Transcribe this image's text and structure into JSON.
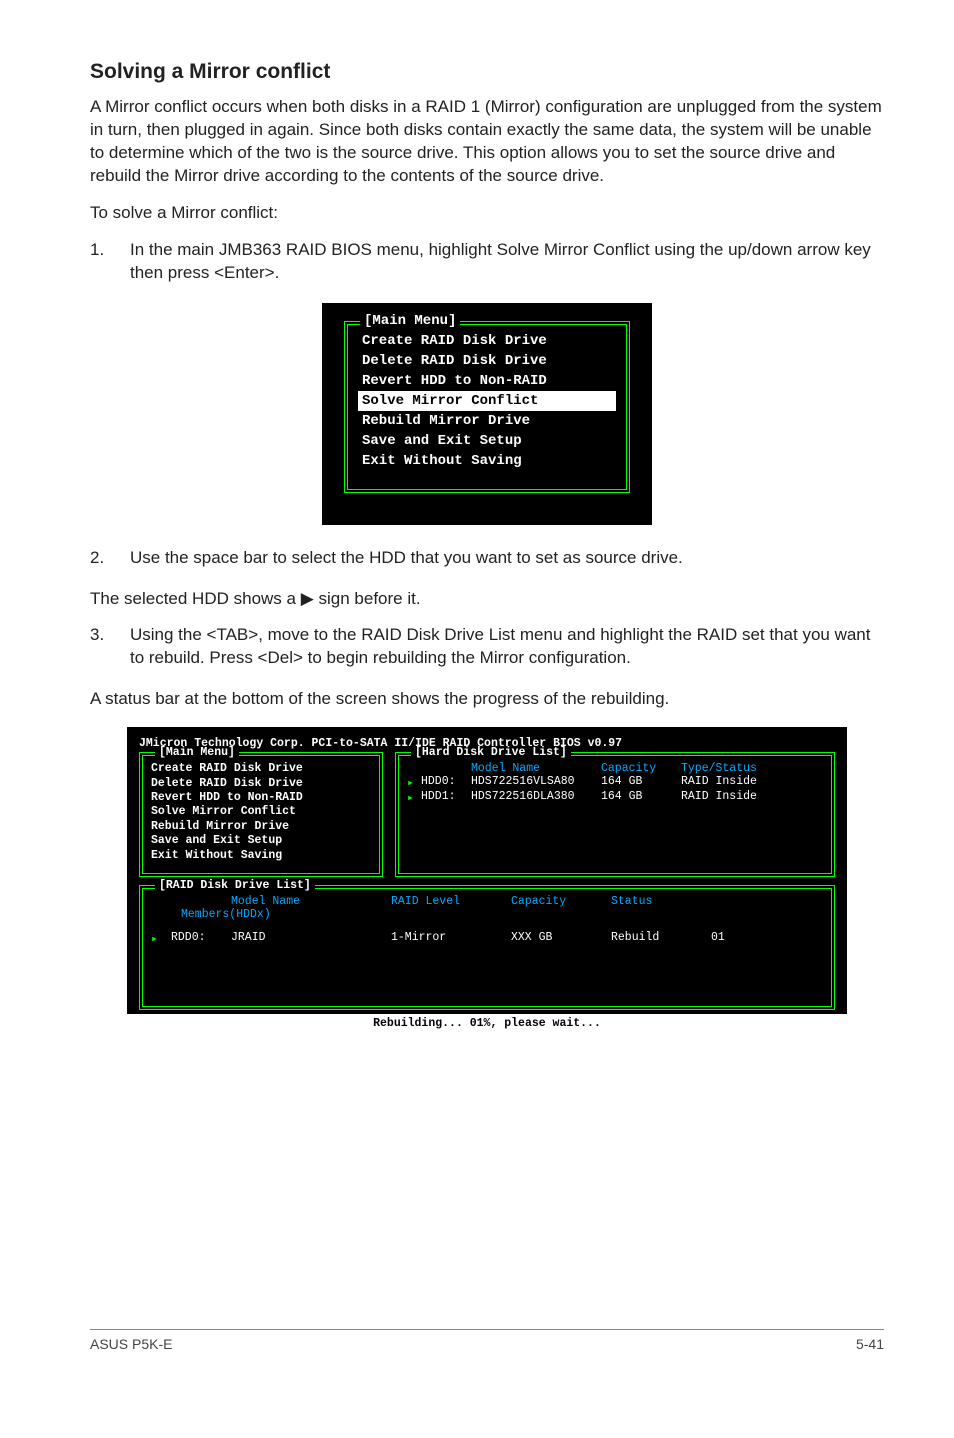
{
  "section": {
    "title": "Solving a Mirror conflict",
    "intro": "A Mirror conflict occurs when both disks in a RAID 1 (Mirror) configuration are unplugged from the system in turn, then plugged in again. Since both disks contain exactly the same data, the system will be unable to determine which of the two is the source drive. This option allows you to set the source drive and rebuild the Mirror drive according to the contents of the source drive.",
    "lead": "To solve a Mirror conflict:"
  },
  "steps": {
    "s1_num": "1.",
    "s1_text": "In the main JMB363 RAID BIOS menu, highlight Solve Mirror Conflict using the up/down arrow key then press <Enter>.",
    "s2_num": "2.",
    "s2_text_a": "Use the space bar to select the HDD that you want to set as source drive.",
    "s2_text_b_pre": "The selected HDD shows a ",
    "s2_text_b_post": " sign before it.",
    "s3_num": "3.",
    "s3_text": "Using the <TAB>, move to the RAID Disk Drive List menu and highlight the RAID set that you want to rebuild. Press <Del> to begin rebuilding the Mirror configuration.",
    "s3_follow": "A status bar at the bottom of the screen shows the progress of the rebuilding."
  },
  "bios_small": {
    "title": "[Main Menu]",
    "items": [
      "Create RAID Disk Drive",
      "Delete RAID Disk Drive",
      "Revert HDD to Non-RAID",
      "Solve Mirror Conflict",
      "Rebuild Mirror Drive",
      "Save and Exit Setup",
      "Exit Without Saving"
    ],
    "selected_index": 3
  },
  "bios_large": {
    "header": "JMicron Technology Corp. PCI-to-SATA II/IDE RAID Controller BIOS v0.97",
    "main_title": "[Main Menu]",
    "main_items": [
      "Create RAID Disk Drive",
      "Delete RAID Disk Drive",
      "Revert HDD to Non-RAID",
      "Solve Mirror Conflict",
      "Rebuild Mirror Drive",
      "Save and Exit Setup",
      "Exit Without Saving"
    ],
    "hdd_title": "[Hard Disk Drive List]",
    "hdd_headers": {
      "model": "Model Name",
      "capacity": "Capacity",
      "type": "Type/Status"
    },
    "hdd_rows": [
      {
        "id": "HDD0:",
        "model": "HDS722516VLSA80",
        "capacity": "164 GB",
        "type": "RAID Inside"
      },
      {
        "id": "HDD1:",
        "model": "HDS722516DLA380",
        "capacity": "164 GB",
        "type": "RAID Inside"
      }
    ],
    "raid_title": "[RAID Disk Drive List]",
    "raid_headers": {
      "model": "Model Name",
      "level": "RAID Level",
      "capacity": "Capacity",
      "status": "Status"
    },
    "raid_members": "Members(HDDx)",
    "raid_rows": [
      {
        "id": "RDD0:",
        "name": "JRAID",
        "level": "1-Mirror",
        "capacity": "XXX GB",
        "status": "Rebuild",
        "members": "01"
      }
    ],
    "rebuild_msg": "Rebuilding... 01%, please wait..."
  },
  "footer": {
    "left": "ASUS P5K-E",
    "right": "5-41"
  }
}
